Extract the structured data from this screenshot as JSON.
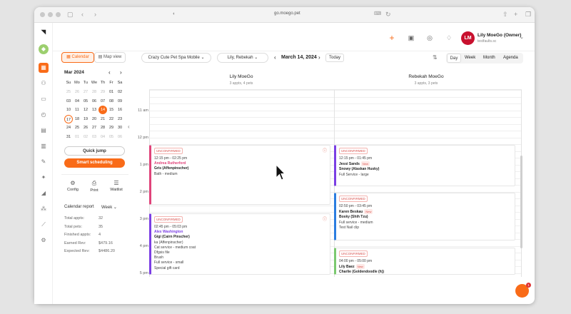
{
  "browser": {
    "url": "go.moego.pet"
  },
  "header": {
    "avatar_initials": "LM",
    "user_name": "Lily MoeGo (Owner)",
    "user_location": "testfaults.sc"
  },
  "toolbar": {
    "calendar_tab": "Calendar",
    "map_tab": "Map view",
    "business": "Crazy Cute Pet Spa Mobile",
    "staff_filter": "Lily, Rebekah",
    "date": "March 14, 2024",
    "today": "Today",
    "views": [
      "Day",
      "Week",
      "Month",
      "Agenda"
    ]
  },
  "mini_calendar": {
    "title": "Mar 2024",
    "weekdays": [
      "Su",
      "Mo",
      "Tu",
      "We",
      "Th",
      "Fr",
      "Sa"
    ],
    "weeks": [
      [
        "25",
        "26",
        "27",
        "28",
        "29",
        "01",
        "02"
      ],
      [
        "03",
        "04",
        "05",
        "06",
        "07",
        "08",
        "09"
      ],
      [
        "10",
        "11",
        "12",
        "13",
        "14",
        "15",
        "16"
      ],
      [
        "17",
        "18",
        "19",
        "20",
        "21",
        "22",
        "23"
      ],
      [
        "24",
        "25",
        "26",
        "27",
        "28",
        "29",
        "30"
      ],
      [
        "31",
        "01",
        "02",
        "03",
        "04",
        "05",
        "06"
      ]
    ]
  },
  "sidebar": {
    "quick_jump": "Quick jump",
    "smart_scheduling": "Smart scheduling",
    "tools": [
      {
        "label": "Config",
        "icon": "gear-icon"
      },
      {
        "label": "Print",
        "icon": "printer-icon"
      },
      {
        "label": "Waitlist",
        "icon": "waitlist-icon"
      }
    ],
    "report_title": "Calendar report",
    "report_period": "Week",
    "stats": [
      {
        "label": "Total appts:",
        "value": "32"
      },
      {
        "label": "Total pets:",
        "value": "35"
      },
      {
        "label": "Finished appts:",
        "value": "4"
      },
      {
        "label": "Earned Rev:",
        "value": "$479.16"
      },
      {
        "label": "Expected Rev:",
        "value": "$4486.20"
      }
    ]
  },
  "columns": [
    {
      "name": "Lily MoeGo",
      "summary": "3 appts, 4 pets"
    },
    {
      "name": "Rebekah MoeGo",
      "summary": "3 appts, 3 pets"
    }
  ],
  "time_labels": [
    "11 am",
    "12 pm",
    "1 pm",
    "2 pm",
    "3 pm",
    "4 pm",
    "5 pm"
  ],
  "appointments": [
    {
      "status": "UNCONFIRMED",
      "color": "#e0447a",
      "lines": [
        "12:15 pm - 02:25 pm",
        "Andrea Rutherford",
        "Gris (Affenpinscher)",
        "Bath - medium"
      ]
    },
    {
      "status": "UNCONFIRMED",
      "color": "#7b3fe4",
      "lines": [
        "02:45 pm - 05:03 pm",
        "Alex Washington",
        "Gigi (Cairn Pinscher)",
        "ka (Affenpinscher)",
        "Cat service - medium coat",
        "Dfgsis file",
        "Brush",
        "Full service - small",
        "Special gift card"
      ]
    },
    {
      "status": "UNCONFIRMED",
      "color": "#7b3fe4",
      "lines": [
        "12:15 pm - 01:45 pm",
        "Jessi Sands",
        "Snowy (Alaskan Husky)",
        "Full Service - large"
      ],
      "new": "New"
    },
    {
      "status": "UNCONFIRMED",
      "color": "#2b7de0",
      "lines": [
        "02:50 pm - 03:45 pm",
        "Karen Beskau",
        "Bosky (Shih Tzu)",
        "Full service - medium",
        "Test Nail clip"
      ],
      "new": "New"
    },
    {
      "status": "UNCONFIRMED",
      "color": "#7bc96f",
      "lines": [
        "04:00 pm - 05:00 pm",
        "Lily Baez",
        "Charlie (Goldendoodle (h))"
      ],
      "new": "New"
    }
  ],
  "chat_badge": "1",
  "colors": {
    "accent": "#f96b18"
  }
}
